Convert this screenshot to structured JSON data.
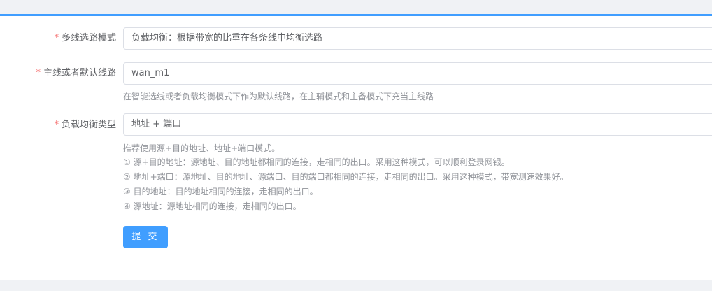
{
  "form": {
    "required_mark": "*",
    "multiline_mode": {
      "label": "多线选路模式",
      "value": "负载均衡：根据带宽的比重在各条线中均衡选路"
    },
    "default_line": {
      "label": "主线或者默认线路",
      "value": "wan_m1",
      "hint": "在智能选线或者负载均衡模式下作为默认线路，在主辅模式和主备模式下充当主线路"
    },
    "balance_type": {
      "label": "负载均衡类型",
      "value": "地址 + 端口",
      "hints": [
        "推荐使用源+目的地址、地址+端口模式。",
        "① 源+目的地址：源地址、目的地址都相同的连接，走相同的出口。采用这种模式，可以顺利登录网银。",
        "② 地址+端口：源地址、目的地址、源端口、目的端口都相同的连接，走相同的出口。采用这种模式，带宽测速效果好。",
        "③ 目的地址：目的地址相同的连接，走相同的出口。",
        "④ 源地址：源地址相同的连接，走相同的出口。"
      ]
    },
    "submit_label": "提 交"
  },
  "colors": {
    "accent": "#409eff",
    "required": "#f56c6c",
    "page_bg": "#f0f2f5"
  }
}
